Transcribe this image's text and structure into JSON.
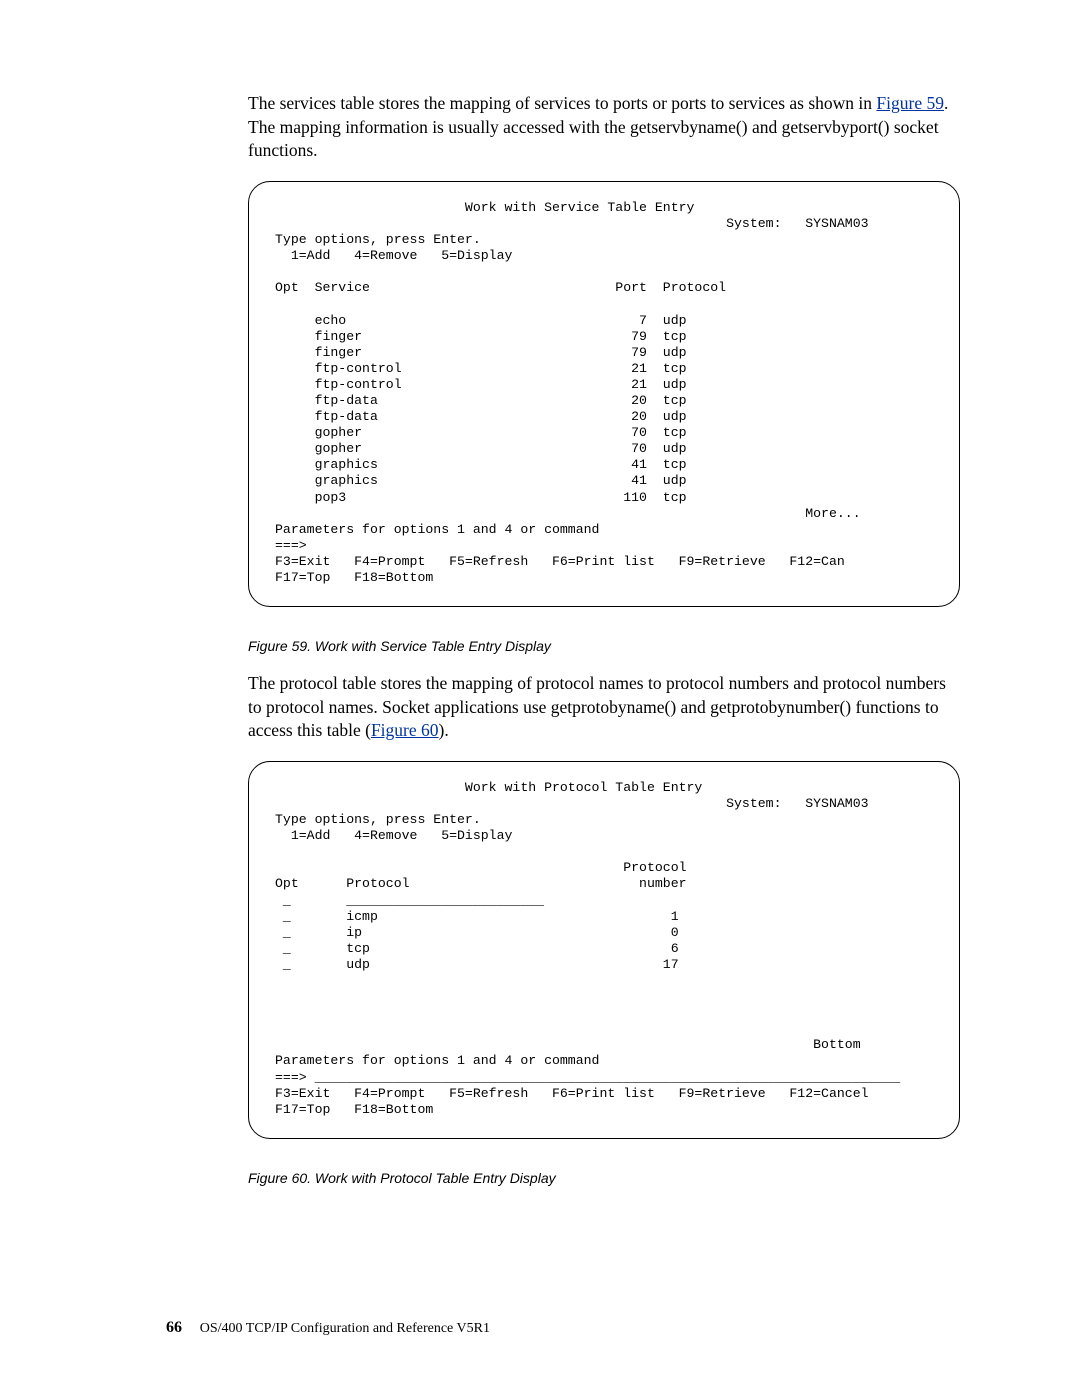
{
  "intro": {
    "pre": "The services table stores the mapping of services to ports or ports to services as shown in ",
    "link": "Figure 59",
    "post": ". The mapping information is usually accessed with the getservbyname() and getservbyport() socket functions."
  },
  "screen1": {
    "title": "Work with Service Table Entry",
    "system_label": "System:",
    "system_name": "SYSNAM03",
    "type_opts": "Type options, press Enter.",
    "opts": "  1=Add   4=Remove   5=Display",
    "header_opt": "Opt",
    "header_service": "Service",
    "header_port": "Port",
    "header_protocol": "Protocol",
    "rows": [
      {
        "svc": "echo",
        "port": "7",
        "proto": "udp"
      },
      {
        "svc": "finger",
        "port": "79",
        "proto": "tcp"
      },
      {
        "svc": "finger",
        "port": "79",
        "proto": "udp"
      },
      {
        "svc": "ftp-control",
        "port": "21",
        "proto": "tcp"
      },
      {
        "svc": "ftp-control",
        "port": "21",
        "proto": "udp"
      },
      {
        "svc": "ftp-data",
        "port": "20",
        "proto": "tcp"
      },
      {
        "svc": "ftp-data",
        "port": "20",
        "proto": "udp"
      },
      {
        "svc": "gopher",
        "port": "70",
        "proto": "tcp"
      },
      {
        "svc": "gopher",
        "port": "70",
        "proto": "udp"
      },
      {
        "svc": "graphics",
        "port": "41",
        "proto": "tcp"
      },
      {
        "svc": "graphics",
        "port": "41",
        "proto": "udp"
      },
      {
        "svc": "pop3",
        "port": "110",
        "proto": "tcp"
      }
    ],
    "more": "More...",
    "params": "Parameters for options 1 and 4 or command",
    "prompt": "===>",
    "fkeys1": "F3=Exit   F4=Prompt   F5=Refresh   F6=Print list   F9=Retrieve   F12=Can",
    "fkeys2": "F17=Top   F18=Bottom"
  },
  "caption1": "Figure 59. Work with Service Table Entry Display",
  "middle": {
    "pre": "The protocol table stores the mapping of protocol names to protocol numbers and protocol numbers to protocol names. Socket applications use getprotobyname() and getprotobynumber() functions to access this table (",
    "link": "Figure 60",
    "post": ")."
  },
  "screen2": {
    "title": "Work with Protocol Table Entry",
    "system_label": "System:",
    "system_name": "SYSNAM03",
    "type_opts": "Type options, press Enter.",
    "opts": "  1=Add   4=Remove   5=Display",
    "header_opt": "Opt",
    "header_protocol": "Protocol",
    "header_pnumber1": "Protocol",
    "header_pnumber2": " number",
    "underscore_left": "_",
    "underscore_right": "_________________________",
    "rows": [
      {
        "u": "_",
        "proto": "icmp",
        "num": "1"
      },
      {
        "u": "_",
        "proto": "ip",
        "num": "0"
      },
      {
        "u": "_",
        "proto": "tcp",
        "num": "6"
      },
      {
        "u": "_",
        "proto": "udp",
        "num": "17"
      }
    ],
    "bottom": "Bottom",
    "params": "Parameters for options 1 and 4 or command",
    "prompt": "===>",
    "cmd_line": "__________________________________________________________________________",
    "fkeys1": "F3=Exit   F4=Prompt   F5=Refresh   F6=Print list   F9=Retrieve   F12=Cancel",
    "fkeys2": "F17=Top   F18=Bottom"
  },
  "caption2": "Figure 60. Work with Protocol Table Entry Display",
  "footer": {
    "page": "66",
    "title": "OS/400 TCP/IP Configuration and Reference V5R1"
  }
}
